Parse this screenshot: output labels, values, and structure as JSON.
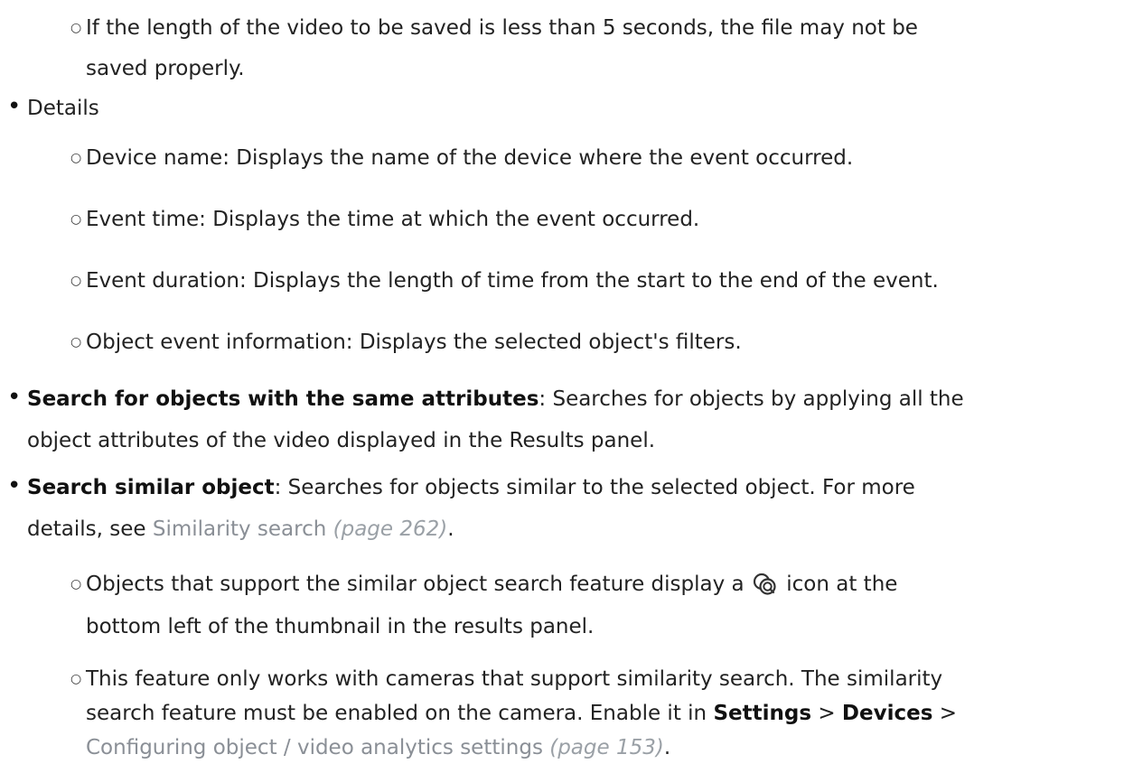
{
  "items": {
    "short_video": {
      "line1": "If the length of the video to be saved is less than 5 seconds, the file may not be",
      "line2": "saved properly."
    },
    "details": {
      "label": "Details",
      "subitems": [
        "Device name: Displays the name of the device where the event occurred.",
        "Event time: Displays the time at which the event occurred.",
        "Event duration: Displays the length of time from the start to the end of the event.",
        "Object event information: Displays the selected object's filters."
      ]
    },
    "same_attributes": {
      "title": "Search for objects with the same attributes",
      "text1": ": Searches for objects by applying all the",
      "line2": "object attributes of the video displayed in the Results panel."
    },
    "similar_object": {
      "title": "Search similar object",
      "text1": ": Searches for objects similar to the selected object. For more",
      "line2_prefix": "details, see ",
      "link_text": "Similarity search",
      "page_ref": "(page 262)",
      "line2_suffix": ".",
      "sub1": {
        "before_icon": "Objects that support the similar object search feature display a",
        "after_icon": "icon at the",
        "line2": "bottom left of the thumbnail in the results panel.",
        "icon": "similarity-search-icon"
      },
      "sub2": {
        "line1": "This feature only works with cameras that support similarity search. The similarity",
        "line2_prefix": "search feature must be enabled on the camera. Enable it in ",
        "settings": "Settings",
        "sep1": " > ",
        "devices": "Devices",
        "sep2": " >",
        "link_text": "Configuring object / video analytics settings",
        "page_ref": "(page 153)",
        "line3_suffix": "."
      }
    }
  },
  "bullets": {
    "main": "•",
    "sub": "○"
  }
}
